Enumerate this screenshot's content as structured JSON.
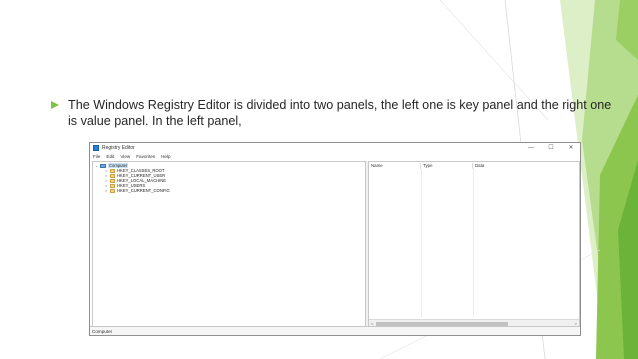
{
  "theme": {
    "accent_green": "#7cc243",
    "light_green": "#a7d57a",
    "pale_green": "#d5ecb9",
    "text_color": "#262626"
  },
  "slide": {
    "bullet_icon": "triangle-bullet-icon",
    "bullet_text": "The Windows Registry Editor is divided into two panels, the left one is key panel and the right one is value panel. In the left panel,"
  },
  "window": {
    "title": "Registry Editor",
    "app_icon": "registry-editor-icon",
    "controls": {
      "minimize": "—",
      "maximize": "☐",
      "close": "✕"
    },
    "menu": [
      "File",
      "Edit",
      "View",
      "Favorites",
      "Help"
    ],
    "tree": {
      "root": {
        "label": "Computer",
        "expander": "⌄",
        "icon": "computer-icon"
      },
      "keys": [
        {
          "label": "HKEY_CLASSES_ROOT",
          "expander": ">",
          "icon": "folder-icon"
        },
        {
          "label": "HKEY_CURRENT_USER",
          "expander": ">",
          "icon": "folder-icon"
        },
        {
          "label": "HKEY_LOCAL_MACHINE",
          "expander": ">",
          "icon": "folder-icon"
        },
        {
          "label": "HKEY_USERS",
          "expander": ">",
          "icon": "folder-icon"
        },
        {
          "label": "HKEY_CURRENT_CONFIG",
          "expander": ">",
          "icon": "folder-icon"
        }
      ]
    },
    "columns": [
      "Name",
      "Type",
      "Data"
    ],
    "scroll_arrows": {
      "left": "<",
      "right": ">"
    },
    "status": "Computer"
  }
}
